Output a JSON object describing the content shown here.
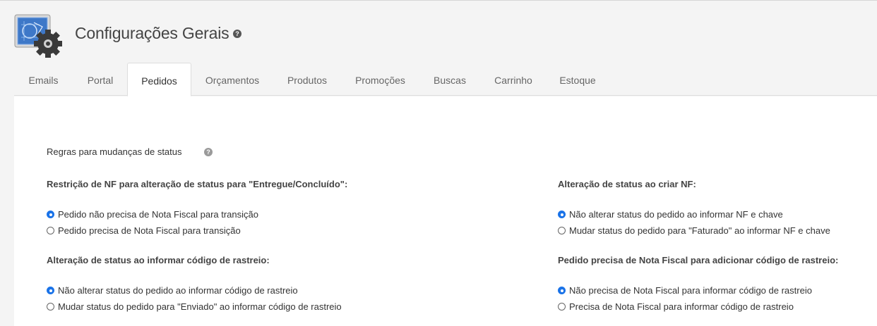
{
  "header": {
    "title": "Configurações Gerais",
    "help_icon": "question-circle-icon",
    "app_icon": "blueprint-gear-icon"
  },
  "tabs": [
    {
      "label": "Emails",
      "active": false
    },
    {
      "label": "Portal",
      "active": false
    },
    {
      "label": "Pedidos",
      "active": true
    },
    {
      "label": "Orçamentos",
      "active": false
    },
    {
      "label": "Produtos",
      "active": false
    },
    {
      "label": "Promoções",
      "active": false
    },
    {
      "label": "Buscas",
      "active": false
    },
    {
      "label": "Carrinho",
      "active": false
    },
    {
      "label": "Estoque",
      "active": false
    }
  ],
  "section": {
    "label": "Regras para mudanças de status",
    "help_icon": "question-circle-icon"
  },
  "groups": {
    "nf_restriction": {
      "title": "Restrição de NF para alteração de status para \"Entregue/Concluído\":",
      "options": [
        {
          "label": "Pedido não precisa de Nota Fiscal para transição",
          "checked": true
        },
        {
          "label": "Pedido precisa de Nota Fiscal para transição",
          "checked": false
        }
      ]
    },
    "status_on_nf": {
      "title": "Alteração de status ao criar NF:",
      "options": [
        {
          "label": "Não alterar status do pedido ao informar NF e chave",
          "checked": true
        },
        {
          "label": "Mudar status do pedido para \"Faturado\" ao informar NF e chave",
          "checked": false
        }
      ]
    },
    "status_on_tracking": {
      "title": "Alteração de status ao informar código de rastreio:",
      "options": [
        {
          "label": "Não alterar status do pedido ao informar código de rastreio",
          "checked": true
        },
        {
          "label": "Mudar status do pedido para \"Enviado\" ao informar código de rastreio",
          "checked": false
        }
      ]
    },
    "nf_for_tracking": {
      "title": "Pedido precisa de Nota Fiscal para adicionar código de rastreio:",
      "options": [
        {
          "label": "Não precisa de Nota Fiscal para informar código de rastreio",
          "checked": true
        },
        {
          "label": "Precisa de Nota Fiscal para informar código de rastreio",
          "checked": false
        }
      ]
    }
  },
  "colors": {
    "accent": "#1a73e8",
    "page_bg": "#f4f4f4",
    "panel_bg": "#ffffff"
  }
}
